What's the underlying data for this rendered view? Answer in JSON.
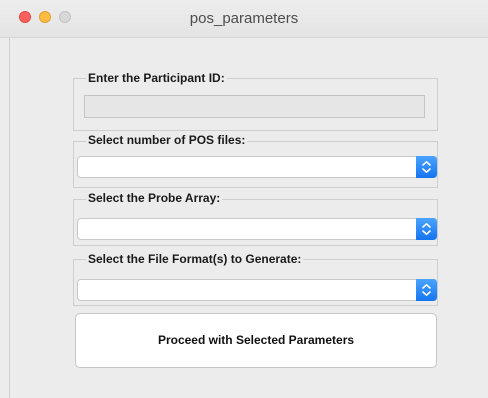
{
  "window": {
    "title": "pos_parameters"
  },
  "participant": {
    "label": "Enter the Participant ID:",
    "value": ""
  },
  "pos_files": {
    "label": "Select number of POS files:",
    "selected": ""
  },
  "probe_array": {
    "label": "Select the Probe Array:",
    "selected": ""
  },
  "file_format": {
    "label": "Select the File Format(s) to Generate:",
    "selected": ""
  },
  "proceed_button": {
    "label": "Proceed with Selected Parameters"
  },
  "colors": {
    "accent": "#1575f0",
    "close": "#fc605c",
    "minimize": "#fdbc40",
    "zoom_disabled": "#d8d8d8"
  }
}
